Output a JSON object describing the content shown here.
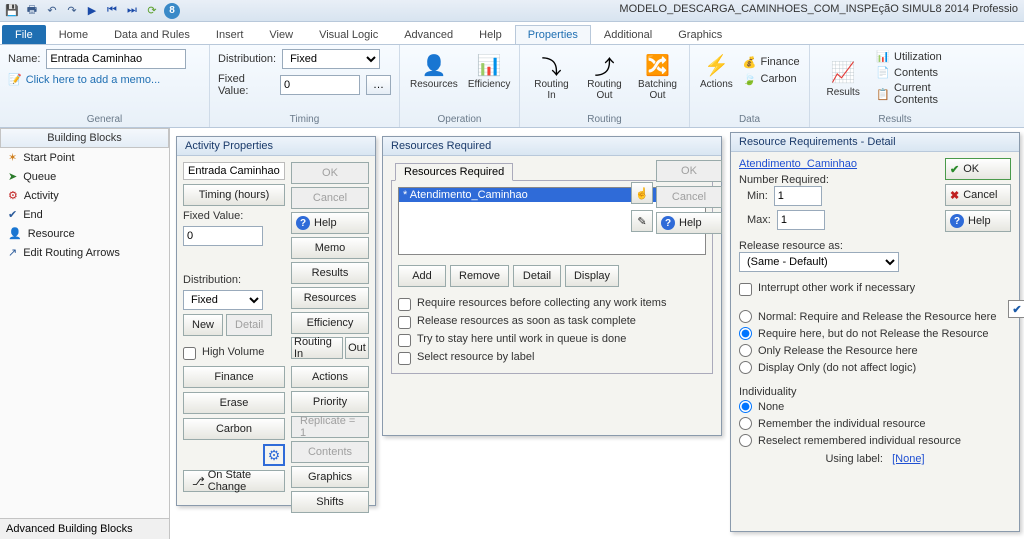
{
  "app": {
    "title_right": "MODELO_DESCARGA_CAMINHOES_COM_INSPEçãO     SIMUL8 2014 Professio"
  },
  "ribbon_tabs": {
    "file": "File",
    "items": [
      "Home",
      "Data and Rules",
      "Insert",
      "View",
      "Visual Logic",
      "Advanced",
      "Help",
      "Properties",
      "Additional",
      "Graphics"
    ],
    "active": "Properties"
  },
  "ribbon": {
    "general": {
      "name_lbl": "Name:",
      "name_val": "Entrada Caminhao",
      "memo_link": "Click here to add a memo...",
      "group": "General"
    },
    "timing": {
      "dist_lbl": "Distribution:",
      "dist_val": "Fixed",
      "fixed_lbl": "Fixed Value:",
      "fixed_val": "0",
      "group": "Timing"
    },
    "operation": {
      "resources": "Resources",
      "efficiency": "Efficiency",
      "group": "Operation"
    },
    "routing": {
      "in": "Routing In",
      "out": "Routing Out",
      "batch": "Batching Out",
      "group": "Routing"
    },
    "data": {
      "actions": "Actions",
      "finance": "Finance",
      "carbon": "Carbon",
      "group": "Data"
    },
    "results": {
      "results": "Results",
      "util": "Utilization",
      "contents": "Contents",
      "current": "Current Contents",
      "group": "Results"
    }
  },
  "bb": {
    "hdr": "Building Blocks",
    "items": [
      "Start Point",
      "Queue",
      "Activity",
      "End",
      "Resource",
      "Edit Routing Arrows"
    ],
    "footer": "Advanced Building Blocks"
  },
  "act_props": {
    "title": "Activity Properties",
    "name": "Entrada Caminhao",
    "timing_btn": "Timing (hours)",
    "fixed_lbl": "Fixed Value:",
    "fixed_val": "0",
    "ok": "OK",
    "cancel": "Cancel",
    "help": "Help",
    "memo": "Memo",
    "results": "Results",
    "resources": "Resources",
    "efficiency": "Efficiency",
    "routing_in": "Routing In",
    "out": "Out",
    "actions": "Actions",
    "priority": "Priority",
    "replicate": "Replicate = 1",
    "contents": "Contents",
    "graphics": "Graphics",
    "shifts": "Shifts",
    "dist_lbl": "Distribution:",
    "dist_val": "Fixed",
    "new": "New",
    "detail": "Detail",
    "highvol": "High Volume",
    "finance": "Finance",
    "erase": "Erase",
    "carbon": "Carbon",
    "onstate": "On State Change"
  },
  "res_req": {
    "title": "Resources Required",
    "tab": "Resources Required",
    "list_item": "* Atendimento_Caminhao",
    "add": "Add",
    "remove": "Remove",
    "detail": "Detail",
    "display": "Display",
    "chk_require_before": "Require resources before collecting any work items",
    "chk_release_asap": "Release resources as soon as task complete",
    "chk_stay": "Try to stay here until work in queue is done",
    "chk_label": "Select resource by label",
    "ok": "OK",
    "cancel": "Cancel",
    "help": "Help"
  },
  "res_detail": {
    "title": "Resource Requirements - Detail",
    "resource_link": "Atendimento_Caminhao",
    "num_req": "Number Required:",
    "min_lbl": "Min:",
    "min_val": "1",
    "max_lbl": "Max:",
    "max_val": "1",
    "release_as": "Release resource as:",
    "release_sel": "(Same - Default)",
    "interrupt": "Interrupt other work if necessary",
    "r_normal": "Normal: Require and Release the Resource here",
    "r_require": "Require here, but do not Release the Resource",
    "r_only": "Only Release the Resource here",
    "r_display": "Display Only (do not affect logic)",
    "indiv": "Individuality",
    "i_none": "None",
    "i_remember": "Remember the individual resource",
    "i_reselect": "Reselect remembered individual resource",
    "using_lbl": "Using label:",
    "using_val": "[None]",
    "ok": "OK",
    "cancel": "Cancel",
    "help": "Help"
  }
}
